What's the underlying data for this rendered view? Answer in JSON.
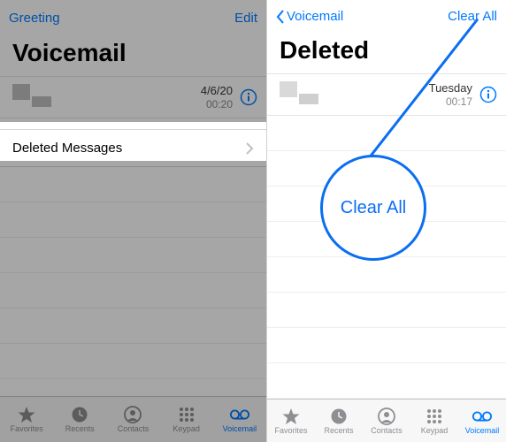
{
  "colors": {
    "accent": "#007aff",
    "dim": "rgba(0,0,0,0.35)"
  },
  "left": {
    "nav_left": "Greeting",
    "nav_right": "Edit",
    "title": "Voicemail",
    "item": {
      "date": "4/6/20",
      "duration": "00:20"
    },
    "deleted_label": "Deleted Messages",
    "tabs": [
      {
        "label": "Favorites",
        "icon": "star-icon",
        "active": false
      },
      {
        "label": "Recents",
        "icon": "clock-icon",
        "active": false
      },
      {
        "label": "Contacts",
        "icon": "contact-icon",
        "active": false
      },
      {
        "label": "Keypad",
        "icon": "keypad-icon",
        "active": false
      },
      {
        "label": "Voicemail",
        "icon": "voicemail-icon",
        "active": true
      }
    ]
  },
  "right": {
    "nav_left": "Voicemail",
    "nav_right": "Clear All",
    "title": "Deleted",
    "item": {
      "date": "Tuesday",
      "duration": "00:17"
    },
    "callout": "Clear All",
    "tabs": [
      {
        "label": "Favorites",
        "icon": "star-icon",
        "active": false
      },
      {
        "label": "Recents",
        "icon": "clock-icon",
        "active": false
      },
      {
        "label": "Contacts",
        "icon": "contact-icon",
        "active": false
      },
      {
        "label": "Keypad",
        "icon": "keypad-icon",
        "active": false
      },
      {
        "label": "Voicemail",
        "icon": "voicemail-icon",
        "active": true
      }
    ]
  }
}
